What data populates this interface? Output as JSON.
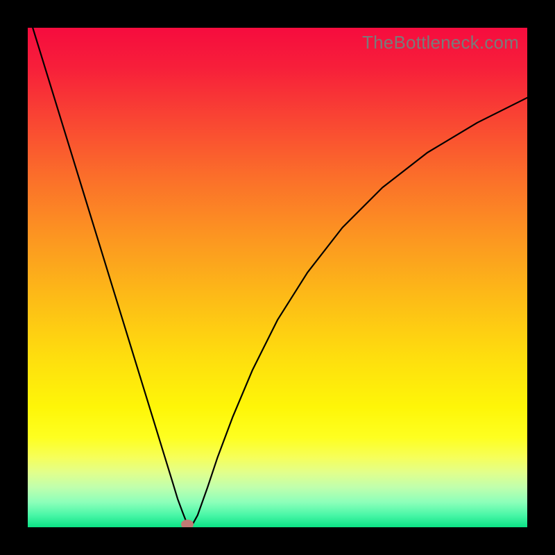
{
  "watermark": "TheBottleneck.com",
  "chart_data": {
    "type": "line",
    "title": "",
    "xlabel": "",
    "ylabel": "",
    "xlim": [
      0,
      100
    ],
    "ylim": [
      0,
      100
    ],
    "grid": false,
    "legend": false,
    "series": [
      {
        "name": "curve",
        "color": "#000000",
        "x": [
          1,
          3,
          5,
          7,
          9,
          11,
          13,
          15,
          17,
          19,
          21,
          23,
          25,
          27,
          29,
          30,
          31,
          31.7,
          32.4,
          33,
          34,
          36,
          38,
          41,
          45,
          50,
          56,
          63,
          71,
          80,
          90,
          100
        ],
        "y": [
          100,
          93.5,
          87,
          80.5,
          74,
          67.5,
          61,
          54.5,
          48,
          41.5,
          35,
          28.5,
          22,
          15.5,
          9,
          5.7,
          3,
          1.2,
          0.3,
          0.6,
          2.4,
          8,
          14,
          22,
          31.5,
          41.5,
          51,
          60,
          68,
          75,
          81,
          86
        ]
      }
    ],
    "marker": {
      "x": 32,
      "y": 0.5,
      "color": "#c07a74"
    },
    "background_gradient": {
      "stops": [
        {
          "offset": 0,
          "color": "#f60c3e"
        },
        {
          "offset": 0.08,
          "color": "#f71f3a"
        },
        {
          "offset": 0.18,
          "color": "#f94433"
        },
        {
          "offset": 0.3,
          "color": "#fb6f2a"
        },
        {
          "offset": 0.42,
          "color": "#fc9621"
        },
        {
          "offset": 0.54,
          "color": "#fdbb17"
        },
        {
          "offset": 0.66,
          "color": "#fede0e"
        },
        {
          "offset": 0.76,
          "color": "#fef608"
        },
        {
          "offset": 0.82,
          "color": "#feff20"
        },
        {
          "offset": 0.86,
          "color": "#f6ff5a"
        },
        {
          "offset": 0.89,
          "color": "#e2ff8b"
        },
        {
          "offset": 0.92,
          "color": "#c0ffad"
        },
        {
          "offset": 0.95,
          "color": "#8cffba"
        },
        {
          "offset": 0.975,
          "color": "#4bf7a8"
        },
        {
          "offset": 1.0,
          "color": "#0be285"
        }
      ]
    }
  }
}
